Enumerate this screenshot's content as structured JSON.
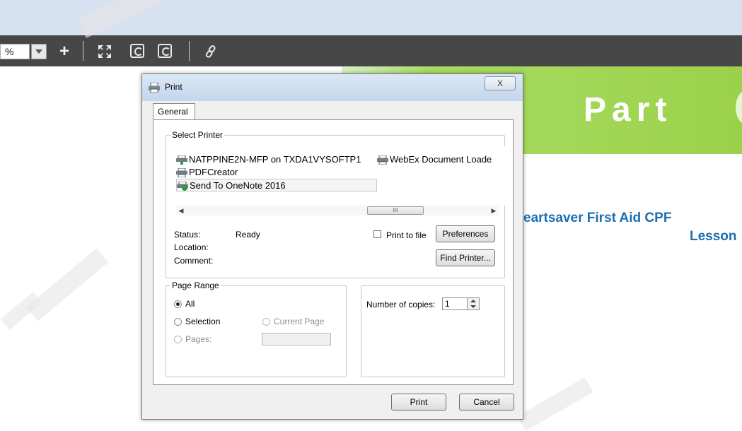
{
  "toolbar": {
    "zoom_value": "%",
    "zoom_in_icon": "plus-icon",
    "fit_icon": "fit-page-icon",
    "rotate_cw_icon": "rotate-clockwise-icon",
    "rotate_ccw_icon": "rotate-counterclockwise-icon",
    "link_icon": "link-icon"
  },
  "page": {
    "title_text": "Part",
    "subtitle_line1": "eartsaver First Aid CPF",
    "subtitle_line2": "Lesson",
    "title_color": "#ffffff",
    "subtitle_color": "#1a6fb3",
    "band_color": "#9bd14a"
  },
  "dialog": {
    "title": "Print",
    "close_label": "X",
    "tab_label": "General",
    "select_printer": {
      "legend": "Select Printer",
      "printers": [
        {
          "name": "NATPPINE2N-MFP on TXDA1VYSOFTP1",
          "icon": "network-printer-icon"
        },
        {
          "name": "WebEx Document Loade",
          "icon": "printer-icon"
        },
        {
          "name": "PDFCreator",
          "icon": "printer-icon"
        },
        {
          "name": "Send To OneNote 2016",
          "icon": "default-printer-icon",
          "selected": true
        }
      ],
      "scroll_thumb_label": "III",
      "status_label": "Status:",
      "status_value": "Ready",
      "location_label": "Location:",
      "comment_label": "Comment:",
      "print_to_file_label": "Print to file",
      "preferences_label": "Preferences",
      "find_printer_label": "Find Printer..."
    },
    "page_range": {
      "legend": "Page Range",
      "all_label": "All",
      "selection_label": "Selection",
      "current_page_label": "Current Page",
      "pages_label": "Pages:"
    },
    "copies": {
      "label": "Number of copies:",
      "value": "1"
    },
    "print_label": "Print",
    "cancel_label": "Cancel"
  }
}
